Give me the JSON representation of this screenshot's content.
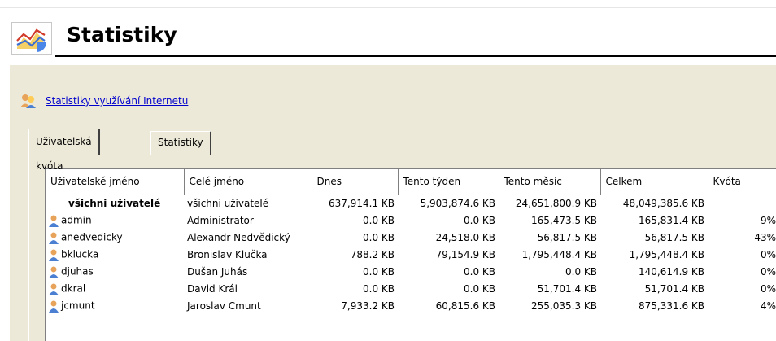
{
  "page": {
    "title": "Statistiky",
    "logo_icon": "statistics-chart-icon"
  },
  "link": {
    "label": "Statistiky využívání Internetu",
    "icon": "users-icon"
  },
  "tabs": [
    {
      "label": "Uživatelská kvóta",
      "active": true
    },
    {
      "label": "Statistiky rozhraní",
      "active": false
    }
  ],
  "table": {
    "columns": [
      "Uživatelské jméno",
      "Celé jméno",
      "Dnes",
      "Tento týden",
      "Tento měsíc",
      "Celkem",
      "Kvóta"
    ],
    "summary": {
      "username": "všichni uživatelé",
      "fullname": "všichni uživatelé",
      "today": "637,914.1 KB",
      "week": "5,903,874.6 KB",
      "month": "24,651,800.9 KB",
      "total": "48,049,385.6 KB"
    },
    "rows": [
      {
        "username": "admin",
        "fullname": "Administrator",
        "today": "0.0 KB",
        "week": "0.0 KB",
        "month": "165,473.5 KB",
        "total": "165,831.4 KB",
        "quota": "9%"
      },
      {
        "username": "anedvedicky",
        "fullname": "Alexandr Nedvědický",
        "today": "0.0 KB",
        "week": "24,518.0 KB",
        "month": "56,817.5 KB",
        "total": "56,817.5 KB",
        "quota": "43%"
      },
      {
        "username": "bklucka",
        "fullname": "Bronislav Klučka",
        "today": "788.2 KB",
        "week": "79,154.9 KB",
        "month": "1,795,448.4 KB",
        "total": "1,795,448.4 KB",
        "quota": "0%"
      },
      {
        "username": "djuhas",
        "fullname": "Dušan Juhás",
        "today": "0.0 KB",
        "week": "0.0 KB",
        "month": "0.0 KB",
        "total": "140,614.9 KB",
        "quota": "0%"
      },
      {
        "username": "dkral",
        "fullname": "David Král",
        "today": "0.0 KB",
        "week": "0.0 KB",
        "month": "51,701.4 KB",
        "total": "51,701.4 KB",
        "quota": "0%"
      },
      {
        "username": "jcmunt",
        "fullname": "Jaroslav Cmunt",
        "today": "7,933.2 KB",
        "week": "60,815.6 KB",
        "month": "255,035.3 KB",
        "total": "875,331.6 KB",
        "quota": "4%"
      }
    ],
    "status_color": "#3cb43c"
  }
}
